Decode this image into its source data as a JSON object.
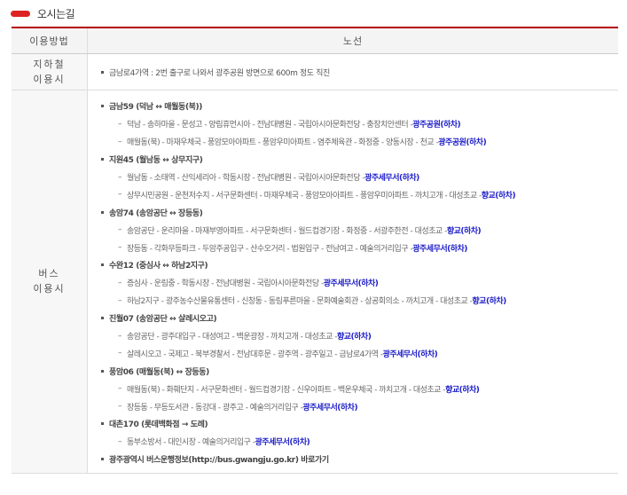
{
  "title": "오시는길",
  "headers": {
    "method": "이용방법",
    "route": "노선"
  },
  "subway": {
    "category": [
      "지하철",
      "이용시"
    ],
    "text": "금남로4가역 : 2번 출구로 나와서 광주공원 방면으로 600m 정도 직진"
  },
  "bus": {
    "category": [
      "버스",
      "이용시"
    ],
    "routes": [
      {
        "name": "금남59 (덕남 ↔ 매월동(북))",
        "branches": [
          {
            "stops": "덕남 - 송하마을 - 문성고 - 양림휴먼시아 - 전남대병원 - 국립아시아문화전당 - 충장치안센터 - ",
            "dest": "광주공원(하차)"
          },
          {
            "stops": "매월동(북) - 마재우체국 - 풍암모아아파트 - 풍암우미아파트 - 염주체육관 - 화정중 - 양동시장 - 천교 - ",
            "dest": "광주공원(하차)"
          }
        ]
      },
      {
        "name": "지원45 (월남동 ↔ 상무지구)",
        "branches": [
          {
            "stops": "월남동 - 소태역 - 산익세리아 - 학동시장 - 전남대병원 - 국립아시아문화전당 - ",
            "dest": "광주세무서(하차)"
          },
          {
            "stops": "상무시민공원 - 운천저수지 - 서구문화센터 - 마재우체국 - 풍암모아아파트 - 풍암우미아파트 - 까치고개 - 대성초교 - ",
            "dest": "향교(하차)"
          }
        ]
      },
      {
        "name": "송암74 (송암공단 ↔ 장등동)",
        "branches": [
          {
            "stops": "송암공단 - 운리마을 - 마재부영아파트 - 서구문화센터 - 월드컵경기장 - 화정중 - 서광주한전 - 대성초교 - ",
            "dest": "향교(하차)"
          },
          {
            "stops": "장등동 - 각화무등파크 - 두암주공입구 - 산수오거리 - 법원입구 - 전남여고 - 예술의거리입구 - ",
            "dest": "광주세무서(하차)"
          }
        ]
      },
      {
        "name": "수완12 (중심사 ↔ 하남2지구)",
        "branches": [
          {
            "stops": "증심사 - 운림중 - 학동시장 - 전남대병원 - 국립아시아문화전당 - ",
            "dest": "광주세무서(하차)"
          },
          {
            "stops": "하남2지구 - 광주농수산물유통센터 - 신창동 - 동림푸른마을 - 문화예술회관 - 상공회의소 - 까치고개 - 대성초교 - ",
            "dest": "향교(하차)"
          }
        ]
      },
      {
        "name": "진월07 (송암공단 ↔ 살레시오고)",
        "branches": [
          {
            "stops": "송암공단 - 광주대입구 - 대성여고 - 백운광장 - 까치고개 - 대성초교 - ",
            "dest": "향교(하차)"
          },
          {
            "stops": "살레시오고 - 국제고 - 북부경찰서 - 전남대후문 - 광주역 - 광주일고 - 금남로4가역 - ",
            "dest": "광주세무서(하차)"
          }
        ]
      },
      {
        "name": "풍암06 (매월동(북) ↔ 장등동)",
        "branches": [
          {
            "stops": "매월동(북) - 화훼단지 - 서구문화센터 - 월드컵경기장 - 신우아파트 - 백운우체국 - 까치고개 - 대성초교 - ",
            "dest": "향교(하차)"
          },
          {
            "stops": "장등동 - 무등도서관 - 동강대 - 광주고 - 예술의거리입구 - ",
            "dest": "광주세무서(하차)"
          }
        ]
      },
      {
        "name": "대촌170 (롯데백화점 → 도례)",
        "branches": [
          {
            "stops": "동부소방서 - 대인시장 - 예술의거리입구 - ",
            "dest": "광주세무서(하차)"
          }
        ]
      }
    ],
    "info": "광주광역시 버스운행정보(http://bus.gwangju.go.kr) 바로가기"
  }
}
